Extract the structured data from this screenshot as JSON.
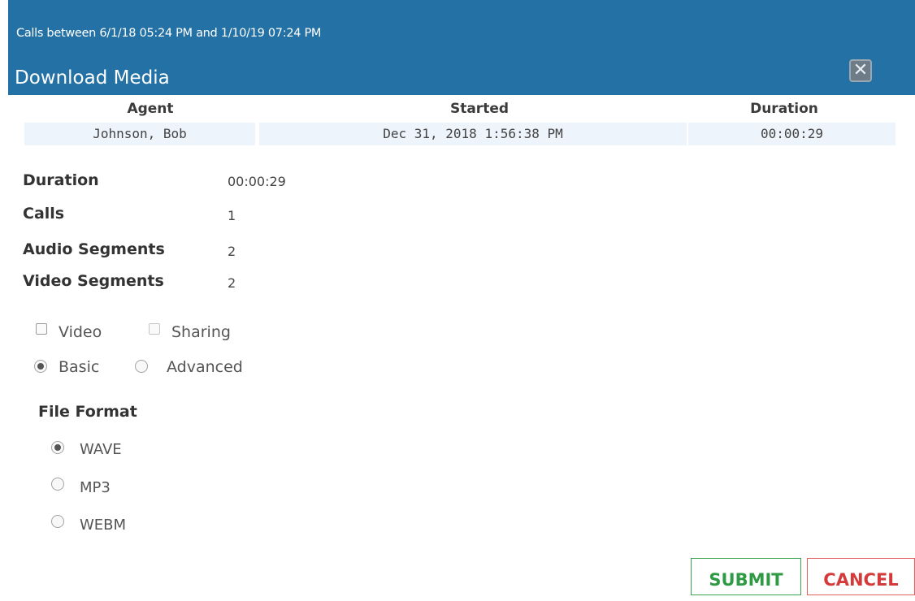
{
  "header": {
    "range_text": "Calls between 6/1/18 05:24 PM and 1/10/19 07:24 PM",
    "title": "Download Media",
    "close_glyph": "✕",
    "background_color": "#2471a5"
  },
  "table": {
    "columns": [
      "Agent",
      "Started",
      "Duration"
    ],
    "rows": [
      [
        "Johnson, Bob",
        "Dec 31, 2018 1:56:38 PM",
        "00:00:29"
      ]
    ]
  },
  "summary": {
    "duration_label": "Duration",
    "duration_value": "00:00:29",
    "calls_label": "Calls",
    "calls_value": "1",
    "audio_label": "Audio Segments",
    "audio_value": "2",
    "video_label": "Video Segments",
    "video_value": "2"
  },
  "options": {
    "video_label": "Video",
    "video_checked": false,
    "sharing_label": "Sharing",
    "sharing_checked": false,
    "basic_label": "Basic",
    "advanced_label": "Advanced",
    "selected_mode": "Basic"
  },
  "file_format": {
    "heading": "File Format",
    "options": [
      "WAVE",
      "MP3",
      "WEBM"
    ],
    "selected": "WAVE"
  },
  "buttons": {
    "submit_label": "SUBMIT",
    "cancel_label": "CANCEL",
    "submit_color": "#2f9a44",
    "cancel_color": "#d43a3a"
  }
}
